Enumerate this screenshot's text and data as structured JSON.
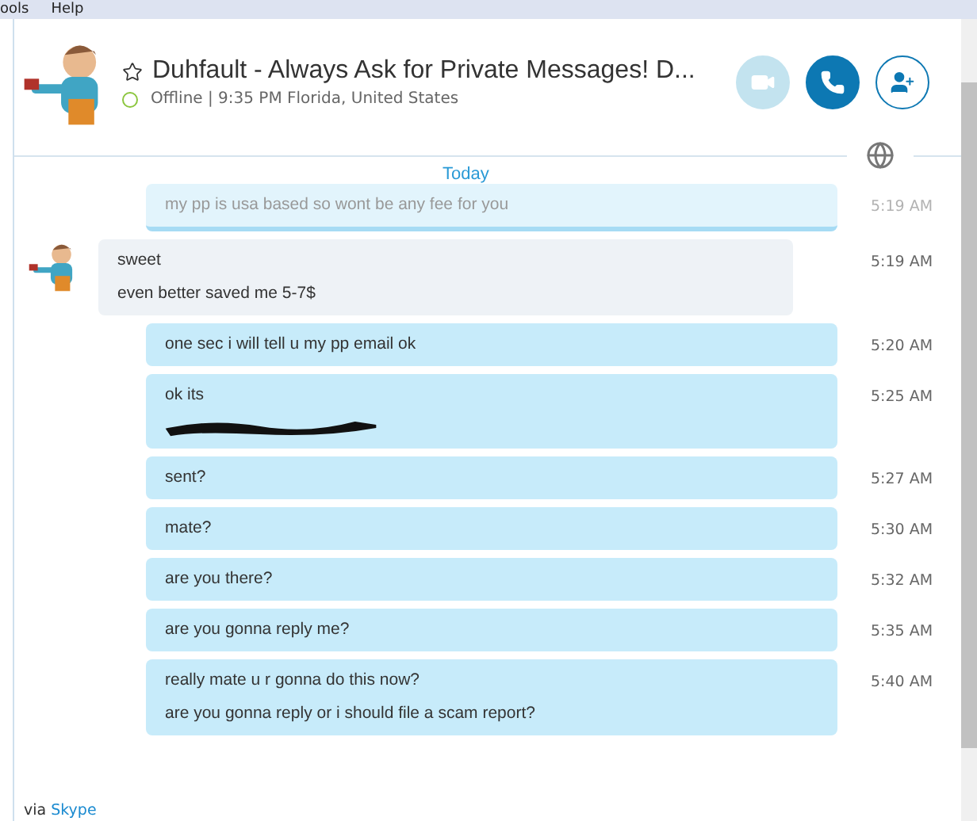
{
  "menu": [
    "ools",
    "Help"
  ],
  "contact": {
    "name": "Duhfault - Always Ask for Private Messages! D...",
    "favorite": false,
    "status": "Offline | 9:35 PM Florida, United States"
  },
  "call_buttons": [
    {
      "kind": "video",
      "disabled": true
    },
    {
      "kind": "call",
      "disabled": false
    },
    {
      "kind": "add_contact",
      "disabled": false
    }
  ],
  "date_divider": "Today",
  "messages": [
    {
      "outgoing": true,
      "faded": true,
      "lines": [
        "my pp is usa based so wont be any fee for you"
      ],
      "time": "5:19 AM"
    },
    {
      "outgoing": false,
      "faded": false,
      "lines": [
        "sweet",
        "even better saved me 5-7$"
      ],
      "time": "5:19 AM"
    },
    {
      "outgoing": true,
      "faded": false,
      "lines": [
        "one sec i will tell u my pp email ok"
      ],
      "time": "5:20 AM"
    },
    {
      "outgoing": true,
      "faded": false,
      "lines": [
        "ok its"
      ],
      "redacted": true,
      "time": "5:25 AM"
    },
    {
      "outgoing": true,
      "faded": false,
      "lines": [
        "sent?"
      ],
      "time": "5:27 AM"
    },
    {
      "outgoing": true,
      "faded": false,
      "lines": [
        "mate?"
      ],
      "time": "5:30 AM"
    },
    {
      "outgoing": true,
      "faded": false,
      "lines": [
        "are you there?"
      ],
      "time": "5:32 AM"
    },
    {
      "outgoing": true,
      "faded": false,
      "lines": [
        "are you gonna reply me?"
      ],
      "time": "5:35 AM"
    },
    {
      "outgoing": true,
      "faded": false,
      "lines": [
        "really mate u r gonna do this now?",
        "are you gonna reply or i should file a scam report?"
      ],
      "time": "5:40 AM"
    }
  ],
  "footer": {
    "prefix": "via",
    "link": "Skype"
  }
}
